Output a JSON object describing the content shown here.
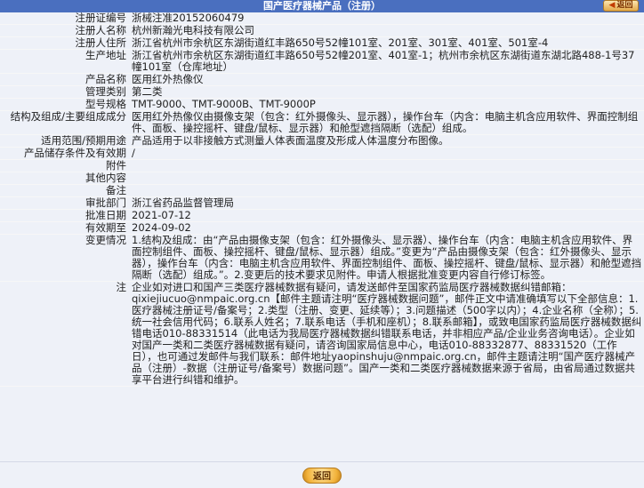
{
  "header": {
    "title": "国产医疗器械产品（注册）",
    "back_label": "返回"
  },
  "fields": [
    {
      "label": "注册证编号",
      "value": "浙械注准20152060479"
    },
    {
      "label": "注册人名称",
      "value": "杭州新瀚光电科技有限公司"
    },
    {
      "label": "注册人住所",
      "value": "浙江省杭州市余杭区东湖街道红丰路650号52幢101室、201室、301室、401室、501室-4"
    },
    {
      "label": "生产地址",
      "value": "浙江省杭州市余杭区东湖街道红丰路650号52幢201室、401室-1；杭州市余杭区东湖街道东湖北路488-1号37幢101室（仓库地址）"
    },
    {
      "label": "产品名称",
      "value": "医用红外热像仪"
    },
    {
      "label": "管理类别",
      "value": "第二类"
    },
    {
      "label": "型号规格",
      "value": "TMT-9000、TMT-9000B、TMT-9000P"
    },
    {
      "label": "结构及组成/主要组成成分",
      "value": "医用红外热像仪由摄像支架（包含：红外摄像头、显示器），操作台车（内含：电脑主机含应用软件、界面控制组件、面板、操控摇杆、键盘/鼠标、显示器）和舱型遮挡隔断（选配）组成。"
    },
    {
      "label": "适用范围/预期用途",
      "value": "产品适用于以非接触方式测量人体表面温度及形成人体温度分布图像。"
    },
    {
      "label": "产品储存条件及有效期",
      "value": "/"
    },
    {
      "label": "附件",
      "value": ""
    },
    {
      "label": "其他内容",
      "value": ""
    },
    {
      "label": "备注",
      "value": ""
    },
    {
      "label": "审批部门",
      "value": "浙江省药品监督管理局"
    },
    {
      "label": "批准日期",
      "value": "2021-07-12"
    },
    {
      "label": "有效期至",
      "value": "2024-09-02"
    },
    {
      "label": "变更情况",
      "value": "1.结构及组成：由“产品由摄像支架（包含：红外摄像头、显示器）、操作台车（内含：电脑主机含应用软件、界面控制组件、面板、操控摇杆、键盘/鼠标、显示器）组成。”变更为“产品由摄像支架（包含：红外摄像头、显示器），操作台车（内含：电脑主机含应用软件、界面控制组件、面板、操控摇杆、键盘/鼠标、显示器）和舱型遮挡隔断（选配）组成。”。2.变更后的技术要求见附件。申请人根据批准变更内容自行修订标签。"
    },
    {
      "label": "注",
      "value": "企业如对进口和国产三类医疗器械数据有疑问，请发送邮件至国家药监局医疗器械数据纠错邮箱：qixiejiucuo@nmpaic.org.cn【邮件主题请注明“医疗器械数据问题”，邮件正文中请准确填写以下全部信息：1.医疗器械注册证号/备案号；2.类型（注册、变更、延续等）；3.问题描述（500字以内）；4.企业名称（全称）；5.统一社会信用代码；6.联系人姓名；7.联系电话（手机和座机）；8.联系邮箱】，或致电国家药监局医疗器械数据纠错电话010-88331514（此电话为我局医疗器械数据纠错联系电话，并非相应产品/企业业务咨询电话）。企业如对国产一类和二类医疗器械数据有疑问，请咨询国家局信息中心，电话010-88332877、88331520（工作日），也可通过发邮件与我们联系：邮件地址yaopinshuju@nmpaic.org.cn，邮件主题请注明“国产医疗器械产品（注册）-数据（注册证号/备案号）数据问题”。国产一类和二类医疗器械数据来源于省局，由省局通过数据共享平台进行纠错和维护。"
    }
  ],
  "footer": {
    "back_label": "返回"
  }
}
